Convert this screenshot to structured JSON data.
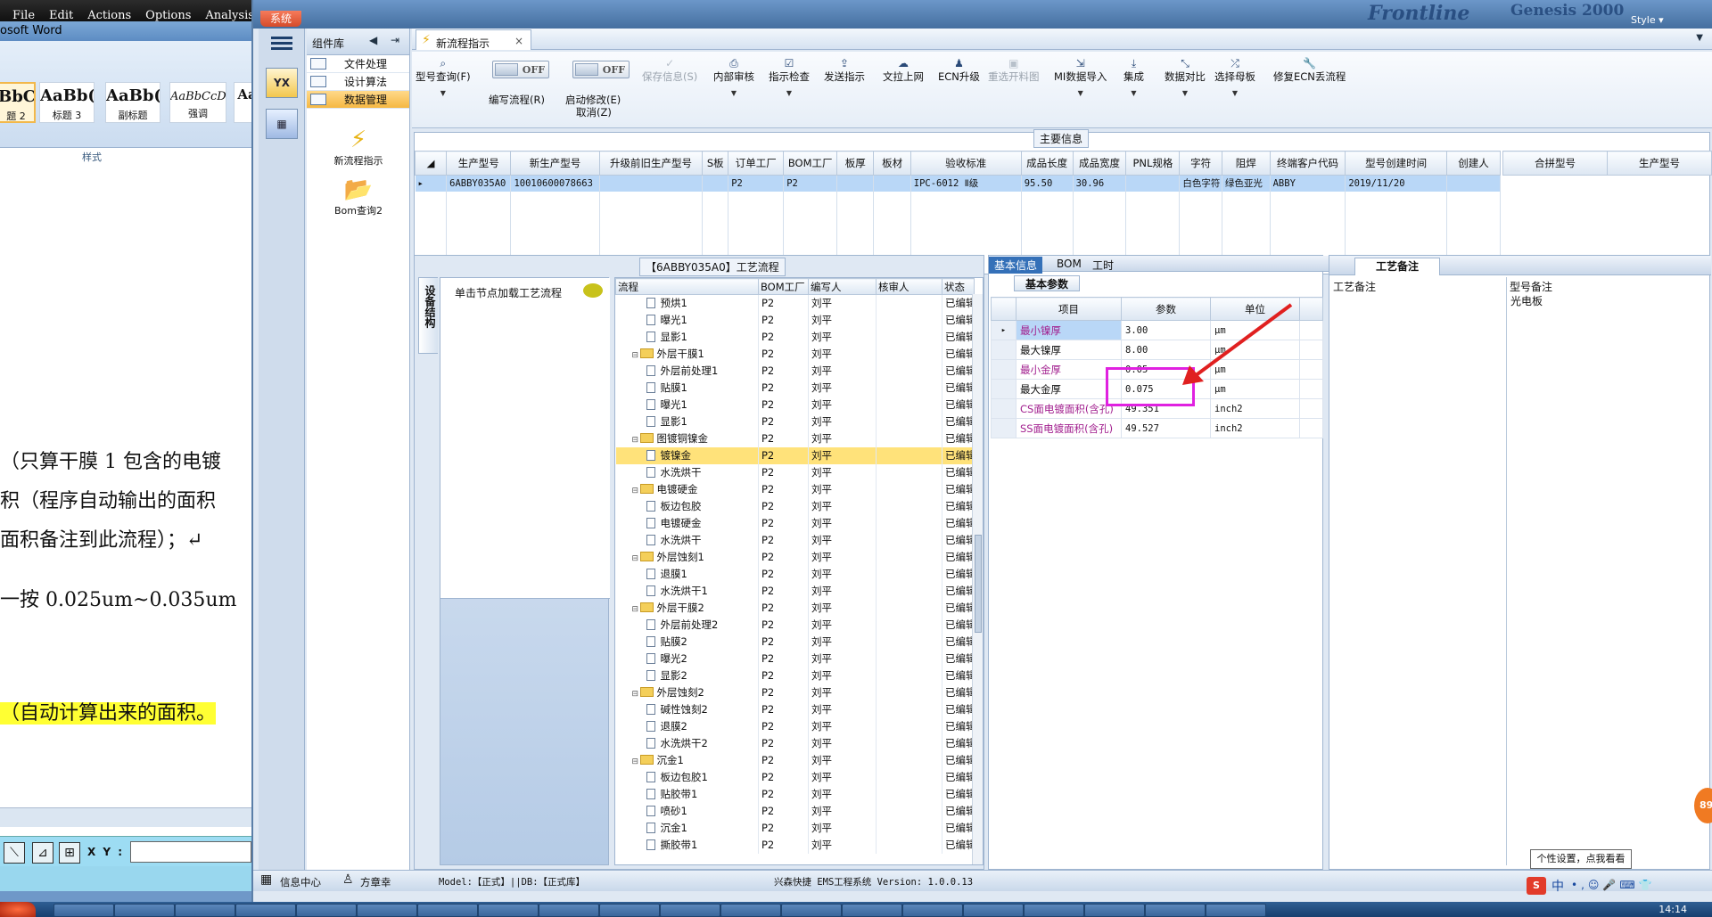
{
  "word": {
    "menu": [
      "File",
      "Edit",
      "Actions",
      "Options",
      "Analysis"
    ],
    "title": "osoft Word",
    "styles": [
      {
        "preview": "BbC",
        "name": "题 2"
      },
      {
        "preview": "AaBb(",
        "name": "标题 3"
      },
      {
        "preview": "AaBb(",
        "name": "副标题"
      },
      {
        "preview": "AaBbCcD",
        "name": "强调"
      },
      {
        "preview": "Aa",
        "name": ""
      }
    ],
    "group_label": "样式",
    "lines": [
      "（只算干膜 1 包含的电镀",
      "积（程序自动输出的面积",
      "面积备注到此流程）；↵",
      "一按 0.025um~0.035um",
      "（自动计算出来的面积。"
    ],
    "xy_label": "X Y :"
  },
  "app": {
    "sys_button": "系统",
    "brand": "Frontline",
    "brand2": "Genesis 2000",
    "style_label": "Style ▾",
    "nav": {
      "icon1": "YX",
      "icon2": ""
    },
    "component_lib": "组件库",
    "menu_items": [
      "文件处理",
      "设计算法",
      "数据管理"
    ],
    "big_tools": [
      "新流程指示",
      "Bom查询2"
    ],
    "doc_tab": "新流程指示",
    "toolbar": {
      "model_query": "型号查询(F)",
      "edit_flow": "编写流程(R)",
      "off": "OFF",
      "enable_edit": "启动修改(E)",
      "cancel": "取消(Z)",
      "save_info": "保存信息(S)",
      "internal_review": "内部审核",
      "indication_check": "指示检查",
      "send_indication": "发送指示",
      "upload_file": "文拉上网",
      "ecn_upgrade": "ECN升级",
      "reopen_drawing": "重选开料图",
      "mi_import": "MI数据导入",
      "integrate": "集成",
      "data_compare": "数据对比",
      "select_master": "选择母板",
      "modify_ecn": "修复ECN丢流程"
    },
    "main_info": {
      "caption": "主要信息",
      "columns": [
        "生产型号",
        "新生产型号",
        "升级前旧生产型号",
        "S板",
        "订单工厂",
        "BOM工厂",
        "板厚",
        "板材",
        "验收标准",
        "成品长度",
        "成品宽度",
        "PNL规格",
        "字符",
        "阻焊",
        "终端客户代码",
        "型号创建时间",
        "创建人"
      ],
      "row": [
        "6ABBY035A0",
        "10010600078663",
        "",
        "",
        "P2",
        "P2",
        "",
        "",
        "IPC-6012 Ⅱ级",
        "95.50",
        "30.96",
        "",
        "白色字符",
        "绿色亚光",
        "ABBY",
        "2019/11/20",
        ""
      ],
      "side_columns": [
        "合拼型号",
        "生产型号"
      ]
    },
    "process": {
      "caption": "【6ABBY035A0】工艺流程",
      "side_tab": "设备结构",
      "node_hint": "单击节点加载工艺流程",
      "columns": [
        "流程",
        "BOM工厂",
        "编写人",
        "核审人",
        "状态"
      ],
      "rows": [
        {
          "lvl": 2,
          "folder": false,
          "name": "预烘1",
          "bom": "P2",
          "writer": "刘平",
          "reviewer": "",
          "status": "已编辑"
        },
        {
          "lvl": 2,
          "folder": false,
          "name": "曝光1",
          "bom": "P2",
          "writer": "刘平",
          "reviewer": "",
          "status": "已编辑"
        },
        {
          "lvl": 2,
          "folder": false,
          "name": "显影1",
          "bom": "P2",
          "writer": "刘平",
          "reviewer": "",
          "status": "已编辑"
        },
        {
          "lvl": 1,
          "folder": true,
          "name": "外层干膜1",
          "bom": "P2",
          "writer": "刘平",
          "reviewer": "",
          "status": "已编辑"
        },
        {
          "lvl": 2,
          "folder": false,
          "name": "外层前处理1",
          "bom": "P2",
          "writer": "刘平",
          "reviewer": "",
          "status": "已编辑"
        },
        {
          "lvl": 2,
          "folder": false,
          "name": "贴膜1",
          "bom": "P2",
          "writer": "刘平",
          "reviewer": "",
          "status": "已编辑"
        },
        {
          "lvl": 2,
          "folder": false,
          "name": "曝光1",
          "bom": "P2",
          "writer": "刘平",
          "reviewer": "",
          "status": "已编辑"
        },
        {
          "lvl": 2,
          "folder": false,
          "name": "显影1",
          "bom": "P2",
          "writer": "刘平",
          "reviewer": "",
          "status": "已编辑"
        },
        {
          "lvl": 1,
          "folder": true,
          "name": "图镀铜镍金",
          "bom": "P2",
          "writer": "刘平",
          "reviewer": "",
          "status": "已编辑"
        },
        {
          "lvl": 2,
          "folder": false,
          "name": "镀镍金",
          "bom": "P2",
          "writer": "刘平",
          "reviewer": "",
          "status": "已编辑",
          "sel": true
        },
        {
          "lvl": 2,
          "folder": false,
          "name": "水洗烘干",
          "bom": "P2",
          "writer": "刘平",
          "reviewer": "",
          "status": "已编辑"
        },
        {
          "lvl": 1,
          "folder": true,
          "name": "电镀硬金",
          "bom": "P2",
          "writer": "刘平",
          "reviewer": "",
          "status": "已编辑"
        },
        {
          "lvl": 2,
          "folder": false,
          "name": "板边包胶",
          "bom": "P2",
          "writer": "刘平",
          "reviewer": "",
          "status": "已编辑"
        },
        {
          "lvl": 2,
          "folder": false,
          "name": "电镀硬金",
          "bom": "P2",
          "writer": "刘平",
          "reviewer": "",
          "status": "已编辑"
        },
        {
          "lvl": 2,
          "folder": false,
          "name": "水洗烘干",
          "bom": "P2",
          "writer": "刘平",
          "reviewer": "",
          "status": "已编辑"
        },
        {
          "lvl": 1,
          "folder": true,
          "name": "外层蚀刻1",
          "bom": "P2",
          "writer": "刘平",
          "reviewer": "",
          "status": "已编辑"
        },
        {
          "lvl": 2,
          "folder": false,
          "name": "退膜1",
          "bom": "P2",
          "writer": "刘平",
          "reviewer": "",
          "status": "已编辑"
        },
        {
          "lvl": 2,
          "folder": false,
          "name": "水洗烘干1",
          "bom": "P2",
          "writer": "刘平",
          "reviewer": "",
          "status": "已编辑"
        },
        {
          "lvl": 1,
          "folder": true,
          "name": "外层干膜2",
          "bom": "P2",
          "writer": "刘平",
          "reviewer": "",
          "status": "已编辑"
        },
        {
          "lvl": 2,
          "folder": false,
          "name": "外层前处理2",
          "bom": "P2",
          "writer": "刘平",
          "reviewer": "",
          "status": "已编辑"
        },
        {
          "lvl": 2,
          "folder": false,
          "name": "贴膜2",
          "bom": "P2",
          "writer": "刘平",
          "reviewer": "",
          "status": "已编辑"
        },
        {
          "lvl": 2,
          "folder": false,
          "name": "曝光2",
          "bom": "P2",
          "writer": "刘平",
          "reviewer": "",
          "status": "已编辑"
        },
        {
          "lvl": 2,
          "folder": false,
          "name": "显影2",
          "bom": "P2",
          "writer": "刘平",
          "reviewer": "",
          "status": "已编辑"
        },
        {
          "lvl": 1,
          "folder": true,
          "name": "外层蚀刻2",
          "bom": "P2",
          "writer": "刘平",
          "reviewer": "",
          "status": "已编辑"
        },
        {
          "lvl": 2,
          "folder": false,
          "name": "碱性蚀刻2",
          "bom": "P2",
          "writer": "刘平",
          "reviewer": "",
          "status": "已编辑"
        },
        {
          "lvl": 2,
          "folder": false,
          "name": "退膜2",
          "bom": "P2",
          "writer": "刘平",
          "reviewer": "",
          "status": "已编辑"
        },
        {
          "lvl": 2,
          "folder": false,
          "name": "水洗烘干2",
          "bom": "P2",
          "writer": "刘平",
          "reviewer": "",
          "status": "已编辑"
        },
        {
          "lvl": 1,
          "folder": true,
          "name": "沉金1",
          "bom": "P2",
          "writer": "刘平",
          "reviewer": "",
          "status": "已编辑"
        },
        {
          "lvl": 2,
          "folder": false,
          "name": "板边包胶1",
          "bom": "P2",
          "writer": "刘平",
          "reviewer": "",
          "status": "已编辑"
        },
        {
          "lvl": 2,
          "folder": false,
          "name": "贴胶带1",
          "bom": "P2",
          "writer": "刘平",
          "reviewer": "",
          "status": "已编辑"
        },
        {
          "lvl": 2,
          "folder": false,
          "name": "喷砂1",
          "bom": "P2",
          "writer": "刘平",
          "reviewer": "",
          "status": "已编辑"
        },
        {
          "lvl": 2,
          "folder": false,
          "name": "沉金1",
          "bom": "P2",
          "writer": "刘平",
          "reviewer": "",
          "status": "已编辑"
        },
        {
          "lvl": 2,
          "folder": false,
          "name": "撕胶带1",
          "bom": "P2",
          "writer": "刘平",
          "reviewer": "",
          "status": "已编辑"
        }
      ]
    },
    "basic": {
      "tabs": [
        "基本信息",
        "BOM",
        "工时"
      ],
      "subtab": "基本参数",
      "columns": [
        "项目",
        "参数",
        "单位"
      ],
      "rows": [
        {
          "name": "最小镍厚",
          "value": "3.00",
          "unit": "μm",
          "pink": true
        },
        {
          "name": "最大镍厚",
          "value": "8.00",
          "unit": "μm",
          "pink": false
        },
        {
          "name": "最小金厚",
          "value": "0.05",
          "unit": "μm",
          "pink": true
        },
        {
          "name": "最大金厚",
          "value": "0.075",
          "unit": "μm",
          "pink": false
        },
        {
          "name": "CS面电镀面积(含孔)",
          "value": "49.351",
          "unit": "inch2",
          "pink": true
        },
        {
          "name": "SS面电镀面积(含孔)",
          "value": "49.527",
          "unit": "inch2",
          "pink": true
        }
      ]
    },
    "remarks": {
      "tab": "工艺备注",
      "col1": "工艺备注",
      "col2": "型号备注",
      "value": "光电板"
    },
    "status": {
      "info_center": "信息中心",
      "user": "方章幸",
      "model": "Model:【正式】||DB:【正式库】",
      "system": "兴森快捷 EMS工程系统 Version: 1.0.0.13"
    },
    "tip": "个性设置，点我看看",
    "floater": "89"
  },
  "taskbar": {
    "clock": "14:14"
  },
  "colors": {
    "accent": "#3470b8",
    "highlight_box": "#e021e0",
    "arrow": "#e02020",
    "selection": "#ffe27a"
  }
}
